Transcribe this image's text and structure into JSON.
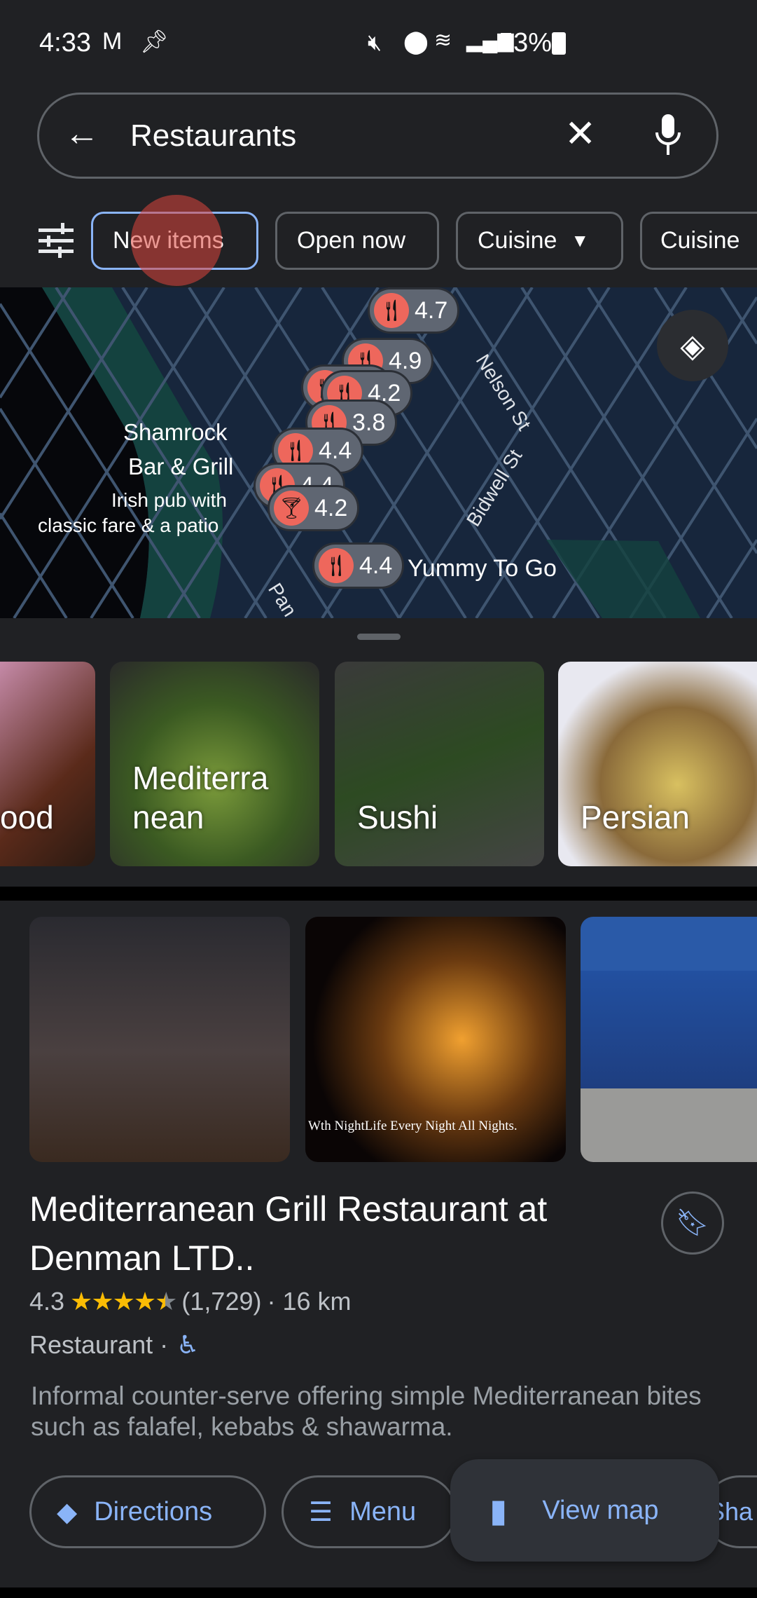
{
  "status_bar": {
    "time": "4:33",
    "battery": "53%",
    "icons": [
      "gmail-icon",
      "pin-icon",
      "mute-icon",
      "location-icon",
      "wifi-icon",
      "signal-icon",
      "battery-icon"
    ]
  },
  "search": {
    "query": "Restaurants",
    "icons": [
      "back-arrow-icon",
      "clear-icon",
      "mic-icon"
    ]
  },
  "chips": [
    {
      "label": "New items"
    },
    {
      "label": "Open now"
    },
    {
      "label": "Cuisine"
    },
    {
      "label": "Cuisine"
    }
  ],
  "map": {
    "pins": [
      {
        "rating": "4.7",
        "type": "restaurant"
      },
      {
        "rating": "4.2",
        "type": "restaurant"
      },
      {
        "rating": "4.9",
        "type": "restaurant"
      },
      {
        "rating": "3.8",
        "type": "restaurant"
      },
      {
        "rating": "4.4",
        "type": "restaurant"
      },
      {
        "rating": "4.4",
        "type": "restaurant"
      },
      {
        "rating": "4.2",
        "type": "bar"
      },
      {
        "rating": "4.4",
        "type": "restaurant"
      }
    ],
    "labels": {
      "shamrock_name1": "Shamrock",
      "shamrock_name2": "Bar & Grill",
      "shamrock_desc1": "Irish pub with",
      "shamrock_desc2": "classic fare & a patio",
      "yummy": "Yummy To Go",
      "nelson": "Nelson St",
      "bidwell": "Bidwell St",
      "pan": "Pan"
    }
  },
  "categories": [
    {
      "label": "ood"
    },
    {
      "label": "Mediterra nean"
    },
    {
      "label": "Sushi"
    },
    {
      "label": "Persian"
    }
  ],
  "photo_caption": "Wth NightLife Every Night All Nights.",
  "result": {
    "title": "Mediterranean Grill Restaurant at Denman LTD..",
    "rating": "4.3",
    "stars": 4.3,
    "reviews": "(1,729)",
    "distance": "· 16 km",
    "type": "Restaurant ·",
    "description": "Informal counter-serve offering simple Mediterranean bites such as falafel, kebabs & shawarma."
  },
  "actions": {
    "directions": "Directions",
    "menu": "Menu",
    "view_map": "View map",
    "share": "Sha"
  },
  "colors": {
    "accent": "#8ab4f8",
    "star": "#fbbc04",
    "pin": "#ee675c"
  }
}
